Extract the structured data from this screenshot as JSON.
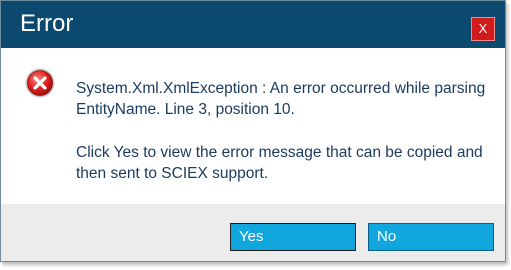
{
  "dialog": {
    "title": "Error",
    "close_label": "X",
    "message_line1": "System.Xml.XmlException : An error occurred while parsing EntityName. Line 3, position 10.",
    "message_line2": "Click Yes to view the error message that can be copied and then sent to SCIEX support.",
    "icon": "error-icon",
    "yes_label": "Yes",
    "no_label": "No"
  },
  "colors": {
    "titlebar": "#0b4a6e",
    "close_button": "#d11a1a",
    "button": "#12a6de",
    "message_text": "#1a3a5e",
    "footer": "#ececec"
  }
}
